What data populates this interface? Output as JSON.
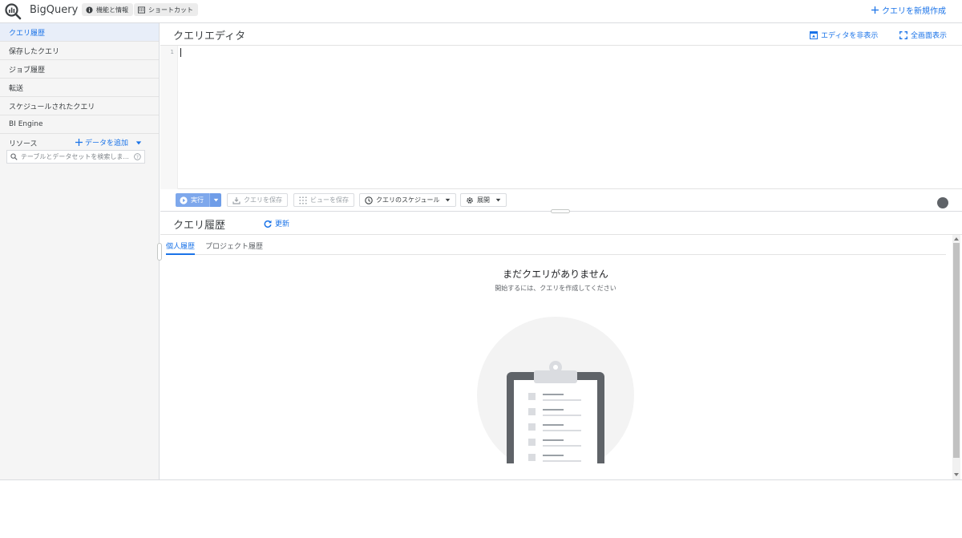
{
  "header": {
    "app_name": "BigQuery",
    "features_chip": "機能と情報",
    "shortcuts_chip": "ショートカット",
    "new_query": "クエリを新規作成"
  },
  "sidebar": {
    "items": [
      {
        "label": "クエリ履歴",
        "active": true
      },
      {
        "label": "保存したクエリ",
        "active": false
      },
      {
        "label": "ジョブ履歴",
        "active": false
      },
      {
        "label": "転送",
        "active": false
      },
      {
        "label": "スケジュールされたクエリ",
        "active": false
      },
      {
        "label": "BI Engine",
        "active": false
      }
    ],
    "resources_label": "リソース",
    "add_data": "データを追加",
    "search_placeholder": "テーブルとデータセットを検索しま..."
  },
  "editor": {
    "title": "クエリエディタ",
    "hide_editor": "エディタを非表示",
    "fullscreen": "全画面表示",
    "line_number": "1"
  },
  "toolbar": {
    "run": "実行",
    "save_query": "クエリを保存",
    "save_view": "ビューを保存",
    "schedule": "クエリのスケジュール",
    "more": "展開"
  },
  "history": {
    "title": "クエリ履歴",
    "refresh": "更新",
    "tabs": [
      "個人履歴",
      "プロジェクト履歴"
    ],
    "empty_title": "まだクエリがありません",
    "empty_subtitle": "開始するには、クエリを作成してください"
  },
  "colors": {
    "accent": "#1a73e8",
    "sidebar_bg": "#f5f5f5",
    "run_button": "#7ea8ec"
  },
  "icons": [
    "bigquery-logo-icon",
    "info-icon",
    "keyboard-icon",
    "plus-icon",
    "hide-editor-icon",
    "fullscreen-icon",
    "play-icon",
    "download-icon",
    "grid-icon",
    "clock-icon",
    "gear-icon",
    "refresh-icon",
    "search-icon",
    "help-icon",
    "clipboard-illustration"
  ]
}
